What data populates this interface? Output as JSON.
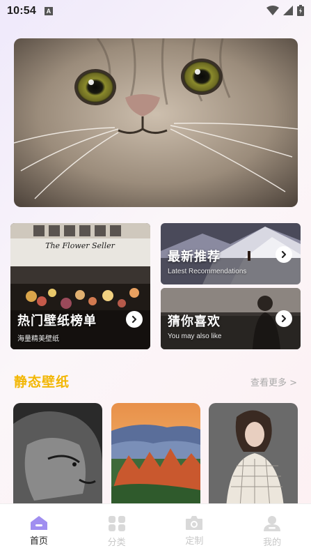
{
  "status_bar": {
    "time": "10:54",
    "badge": "A"
  },
  "hero": {
    "image": "cat-photo"
  },
  "cards": [
    {
      "title": "热门壁纸榜单",
      "subtitle": "海量精美壁纸",
      "image": "flower-shop-photo"
    },
    {
      "title": "最新推荐",
      "subtitle": "Latest Recommendations",
      "image": "snowy-mountain-photo"
    },
    {
      "title": "猜你喜欢",
      "subtitle": "You may also like",
      "image": "man-at-sea-photo"
    }
  ],
  "static_section": {
    "title": "静态壁纸",
    "more": "查看更多 >",
    "thumbs": [
      "lion-photo",
      "canyon-landscape-photo",
      "woman-in-blazer-photo"
    ]
  },
  "tabbar": {
    "items": [
      {
        "label": "首页",
        "icon": "home-icon"
      },
      {
        "label": "分类",
        "icon": "grid-icon"
      },
      {
        "label": "定制",
        "icon": "camera-icon"
      },
      {
        "label": "我的",
        "icon": "user-icon"
      }
    ],
    "active_color": "#a08ef0",
    "inactive_color": "#d9d9d9"
  },
  "colors": {
    "accent_yellow": "#f2b705"
  }
}
